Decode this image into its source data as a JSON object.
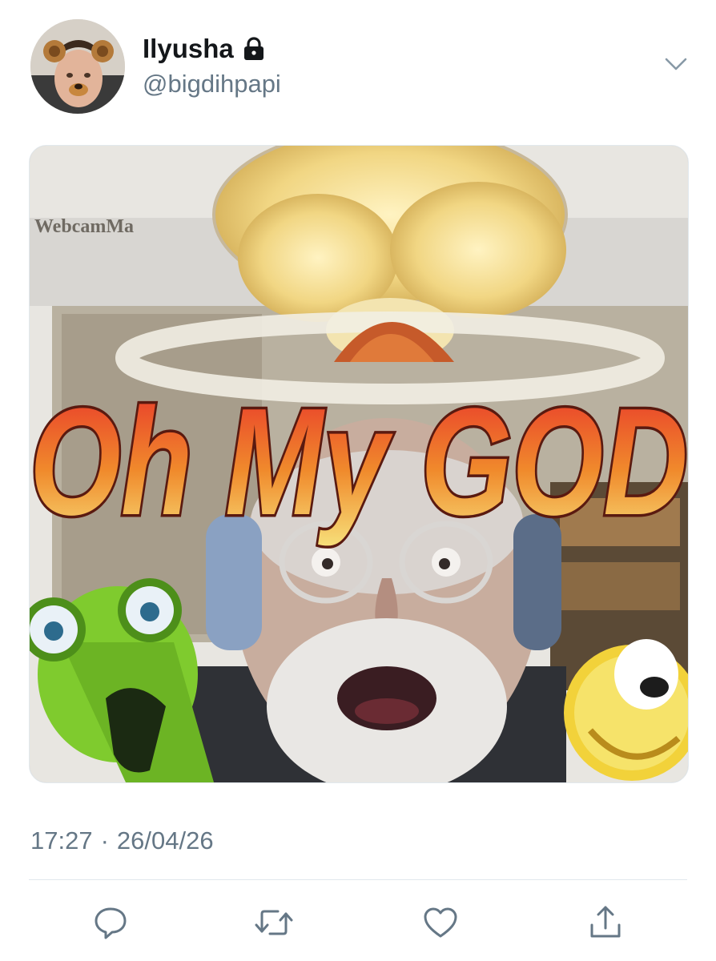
{
  "tweet": {
    "author": {
      "display_name": "Ilyusha",
      "handle": "@bigdihpapi",
      "protected_icon": "lock-icon",
      "avatar_icon": "profile-avatar"
    },
    "more_menu_icon": "chevron-down-icon",
    "media": {
      "watermark_text": "WebcamMa",
      "overlay_text": "Oh My GOD"
    },
    "time": "17:27",
    "separator": "·",
    "date": "26/04/26"
  },
  "actions": [
    {
      "name": "reply",
      "icon": "reply-icon"
    },
    {
      "name": "retweet",
      "icon": "retweet-icon"
    },
    {
      "name": "like",
      "icon": "heart-icon"
    },
    {
      "name": "share",
      "icon": "share-icon"
    }
  ],
  "colors": {
    "text_primary": "#14171a",
    "text_secondary": "#657786",
    "icon": "#657786",
    "divider": "#e1e8ed"
  }
}
